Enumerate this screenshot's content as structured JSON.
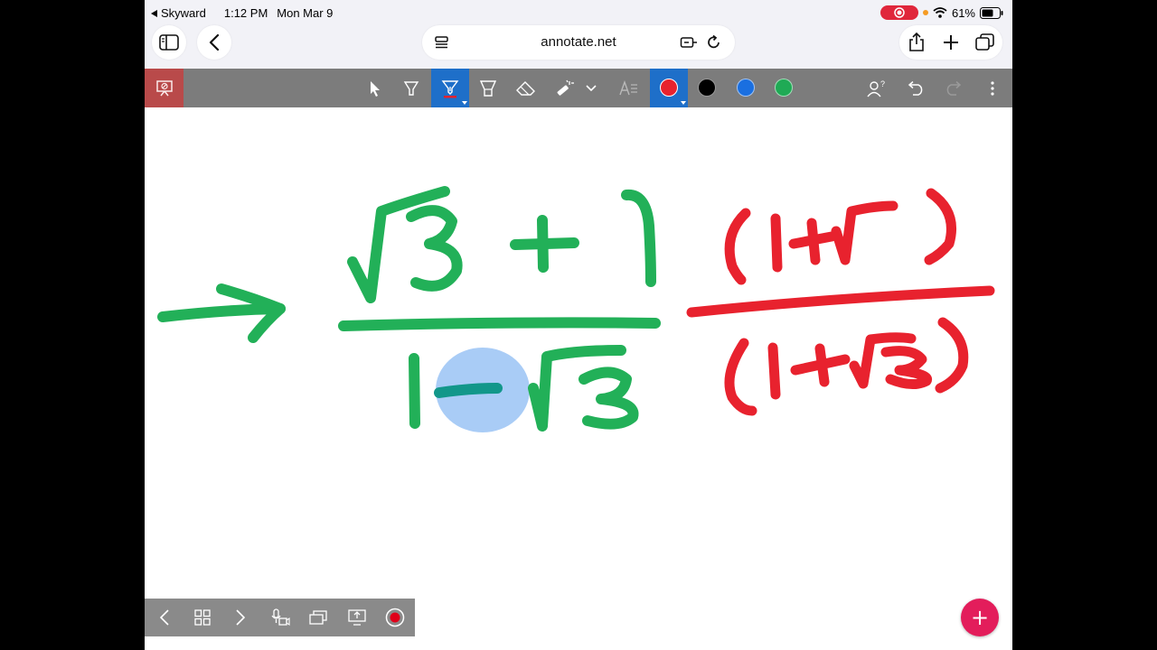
{
  "status": {
    "back_app": "Skyward",
    "time": "1:12 PM",
    "date": "Mon Mar 9",
    "battery": "61%"
  },
  "browser": {
    "url": "annotate.net"
  },
  "toolbar": {
    "tools": [
      "select-icon",
      "highlighter-icon",
      "pen-icon",
      "marker-icon",
      "eraser-icon",
      "laser-icon",
      "chevron-down-icon",
      "text-icon"
    ],
    "active_tool": "pen",
    "colors": [
      "#e8222e",
      "#000000",
      "#1a6fe0",
      "#1faa55"
    ],
    "active_color": "#e8222e"
  },
  "canvas": {
    "ink_green": "#22b058",
    "ink_red": "#e8222e",
    "ink_teal": "#12978a",
    "highlight_blue": "#a9ccf6"
  },
  "bottom": {
    "buttons": [
      "prev-page-icon",
      "grid-icon",
      "next-page-icon",
      "mic-camera-icon",
      "pages-icon",
      "share-screen-icon",
      "record-icon"
    ]
  },
  "fab": {
    "label": "+"
  }
}
